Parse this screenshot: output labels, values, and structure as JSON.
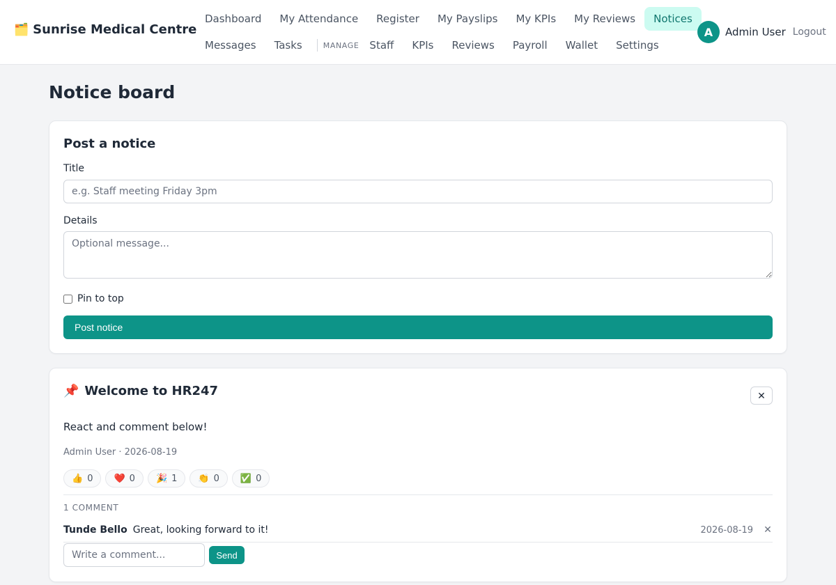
{
  "brand": {
    "icon": "🗂️",
    "name": "Sunrise Medical Centre"
  },
  "nav": {
    "row1": [
      "Dashboard",
      "My Attendance",
      "Register",
      "My Payslips",
      "My KPIs",
      "My Reviews",
      "Notices"
    ],
    "row2_personal": [
      "Messages",
      "Tasks"
    ],
    "section_label": "MANAGE",
    "row2_manage": [
      "Staff",
      "KPIs",
      "Reviews",
      "Payroll",
      "Wallet",
      "Settings"
    ],
    "active": "Notices"
  },
  "user": {
    "initial": "A",
    "name": "Admin User",
    "logout_label": "Logout"
  },
  "page": {
    "title": "Notice board"
  },
  "post_form": {
    "heading": "Post a notice",
    "title_label": "Title",
    "title_placeholder": "e.g. Staff meeting Friday 3pm",
    "title_value": "",
    "details_label": "Details",
    "details_placeholder": "Optional message...",
    "details_value": "",
    "pin_label": "Pin to top",
    "pin_checked": false,
    "submit_label": "Post notice"
  },
  "notice": {
    "pin_icon": "📌",
    "title": "Welcome to HR247",
    "close_label": "✕",
    "body": "React and comment below!",
    "meta": "Admin User · 2026-08-19",
    "reactions": [
      {
        "emoji": "👍",
        "count": "0"
      },
      {
        "emoji": "❤️",
        "count": "0"
      },
      {
        "emoji": "🎉",
        "count": "1"
      },
      {
        "emoji": "👏",
        "count": "0"
      },
      {
        "emoji": "✅",
        "count": "0"
      }
    ],
    "comments_heading": "1 COMMENT",
    "comments": [
      {
        "author": "Tunde Bello",
        "text": "Great, looking forward to it!",
        "date": "2026-08-19",
        "delete_label": "✕"
      }
    ],
    "comment_placeholder": "Write a comment...",
    "send_label": "Send"
  },
  "colors": {
    "accent": "#0d9488",
    "accent_light": "#ccfbf1",
    "page_bg": "#f3f4f6"
  }
}
